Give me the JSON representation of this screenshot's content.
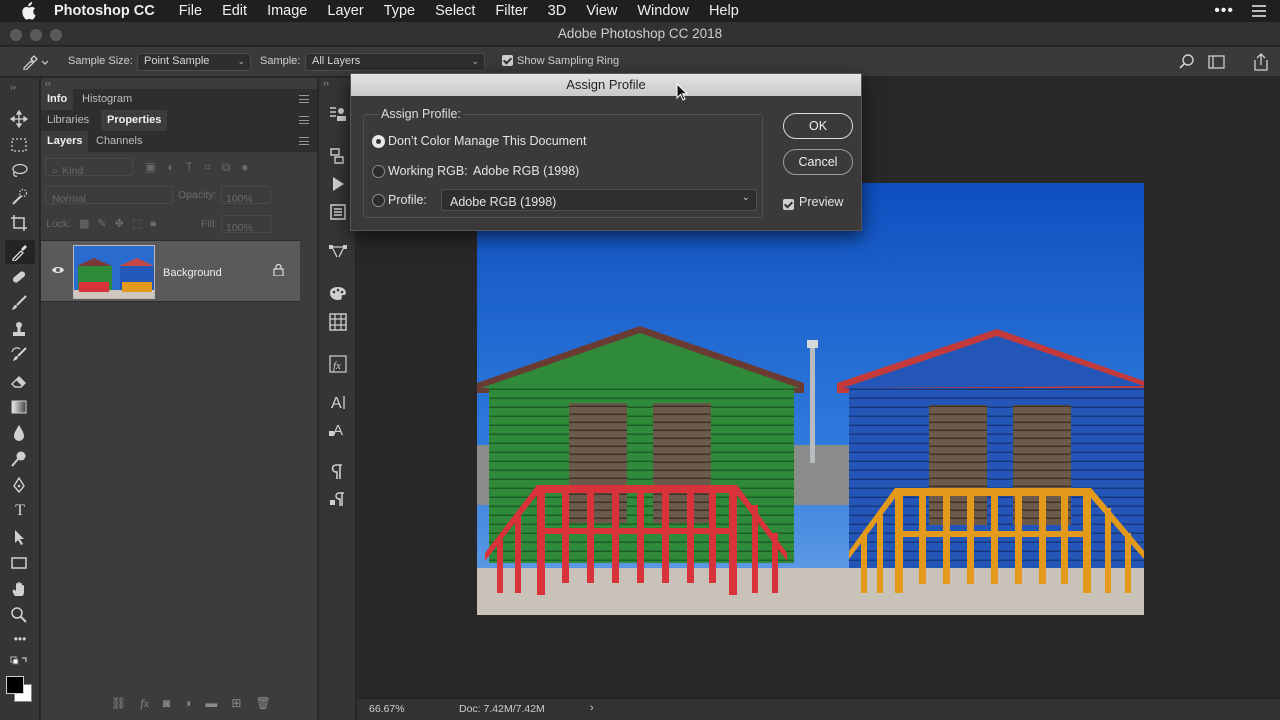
{
  "menubar": {
    "app_name": "Photoshop CC",
    "items": [
      "File",
      "Edit",
      "Image",
      "Layer",
      "Type",
      "Select",
      "Filter",
      "3D",
      "View",
      "Window",
      "Help"
    ]
  },
  "window": {
    "title": "Adobe Photoshop CC 2018"
  },
  "options_bar": {
    "sample_size_label": "Sample Size:",
    "sample_size_value": "Point Sample",
    "sample_label": "Sample:",
    "sample_value": "All Layers",
    "show_sampling_ring_label": "Show Sampling Ring",
    "show_sampling_ring_checked": true
  },
  "panels": {
    "row1": {
      "tabs": [
        "Info",
        "Histogram"
      ],
      "active": "Info"
    },
    "row2": {
      "tabs": [
        "Libraries",
        "Properties"
      ],
      "active": "Properties"
    },
    "row3": {
      "tabs": [
        "Layers",
        "Channels"
      ],
      "active": "Layers"
    },
    "filter_kind": "Kind",
    "blend_mode": "Normal",
    "opacity_label": "Opacity:",
    "opacity_value": "100%",
    "lock_label": "Lock:",
    "fill_label": "Fill:",
    "fill_value": "100%",
    "layers": [
      {
        "name": "Background",
        "visible": true,
        "locked": true
      }
    ]
  },
  "dialog": {
    "title": "Assign Profile",
    "group_label": "Assign Profile:",
    "option_dont": "Don’t Color Manage This Document",
    "option_working_label": "Working RGB:",
    "option_working_value": "Adobe RGB (1998)",
    "option_profile_label": "Profile:",
    "profile_value": "Adobe RGB (1998)",
    "selected_option": "dont",
    "ok_label": "OK",
    "cancel_label": "Cancel",
    "preview_label": "Preview",
    "preview_checked": true
  },
  "status": {
    "zoom": "66.67%",
    "doc_info": "Doc: 7.42M/7.42M"
  },
  "colors": {
    "accent_green": "#2f8a3a",
    "accent_blue": "#2456b8",
    "rail_red": "#d8323a",
    "rail_orange": "#e39a1b",
    "sky": "#1d63c9"
  }
}
